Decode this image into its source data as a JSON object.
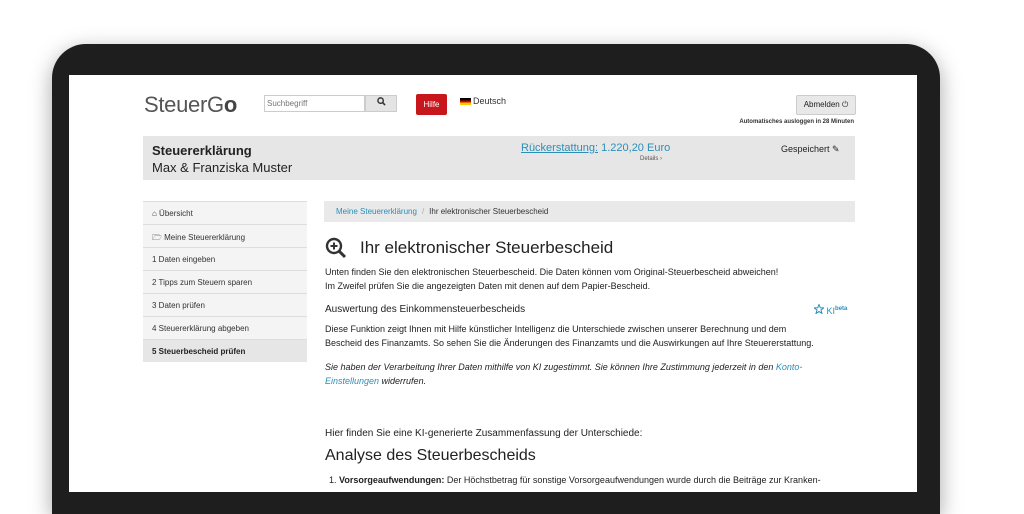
{
  "header": {
    "logo_a": "SteuerG",
    "logo_b": "o",
    "search_placeholder": "Suchbegriff",
    "search_icon": "magnifier-icon",
    "help_label": "Hilfe",
    "language_label": "Deutsch",
    "logout_label": "Abmelden ⏻",
    "auto_logout_text": "Automatisches ausloggen in 28 Minuten"
  },
  "summary": {
    "title": "Steuererklärung",
    "names": "Max & Franziska Muster",
    "refund_label": "Rückerstattung:",
    "refund_value": "1.220,20 Euro",
    "details_label": "Details ›",
    "saved_label": "Gespeichert ✎"
  },
  "sidebar": {
    "items": [
      {
        "label": "⌂ Übersicht",
        "active": false
      },
      {
        "label": "🗁 Meine Steuererklärung",
        "active": false
      },
      {
        "label": "1 Daten eingeben",
        "active": false
      },
      {
        "label": "2 Tipps zum Steuern sparen",
        "active": false
      },
      {
        "label": "3 Daten prüfen",
        "active": false
      },
      {
        "label": "4 Steuererklärung abgeben",
        "active": false
      },
      {
        "label": "5 Steuerbescheid prüfen",
        "active": true
      }
    ]
  },
  "breadcrumb": {
    "link": "Meine Steuererklärung",
    "separator": "/",
    "current": "Ihr elektronischer Steuerbescheid"
  },
  "main": {
    "title": "Ihr elektronischer Steuerbescheid",
    "intro_1": "Unten finden Sie den elektronischen Steuerbescheid. Die Daten können vom Original-Steuerbescheid abweichen!",
    "intro_2": "Im Zweifel prüfen Sie die angezeigten Daten mit denen auf dem Papier-Bescheid.",
    "section_title": "Auswertung des Einkommensteuerbescheids",
    "ki_label": "KI",
    "ki_badge": "beta",
    "section_text_1": "Diese Funktion zeigt Ihnen mit Hilfe künstlicher Intelligenz die Unterschiede zwischen unserer Berechnung und dem",
    "section_text_2": "Bescheid des Finanzamts. So sehen Sie die Änderungen des Finanzamts und die Auswirkungen auf Ihre Steuererstattung.",
    "consent_1": "Sie haben der Verarbeitung Ihrer Daten mithilfe von KI zugestimmt. Sie können Ihre Zustimmung jederzeit in den ",
    "consent_link_1": "Konto-",
    "consent_link_2": "Einstellungen",
    "consent_2": " widerrufen.",
    "summary_intro": "Hier finden Sie eine KI-generierte Zusammenfassung der Unterschiede:",
    "analysis_title": "Analyse des Steuerbescheids",
    "list_item_1_bold": "Vorsorgeaufwendungen:",
    "list_item_1_text": " Der Höchstbetrag für sonstige Vorsorgeaufwendungen wurde durch die Beiträge zur Kranken-"
  },
  "colors": {
    "accent": "#2a8fb8",
    "help_button": "#c8161d",
    "band": "#e6e6e6"
  }
}
